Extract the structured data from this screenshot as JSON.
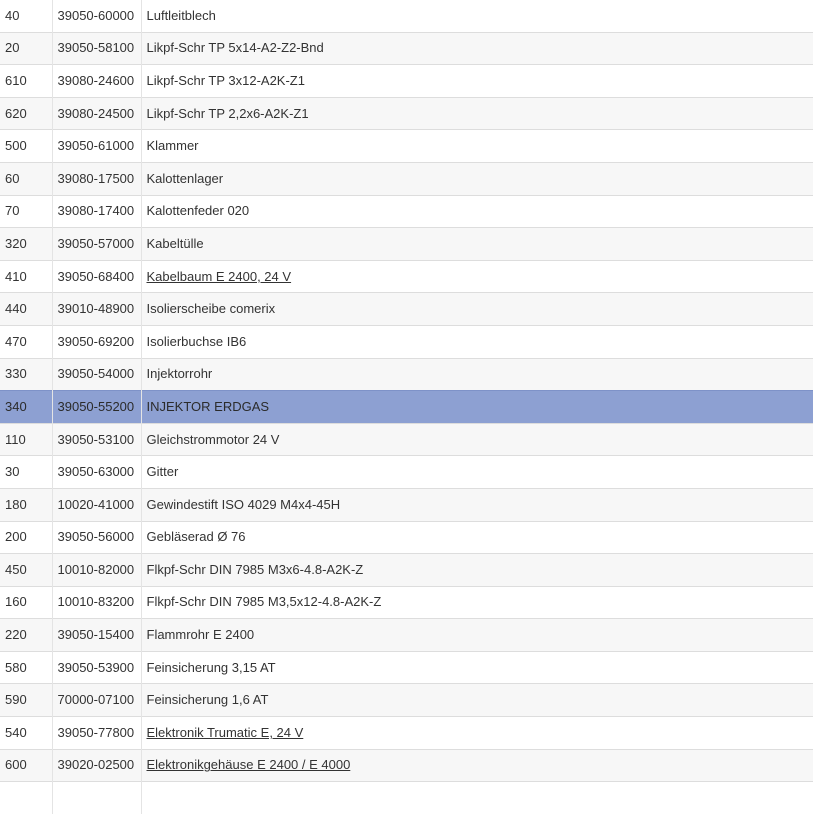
{
  "parts": [
    {
      "pos": "40",
      "number": "39050-60000",
      "description": "Luftleitblech",
      "link": false
    },
    {
      "pos": "20",
      "number": "39050-58100",
      "description": "Likpf-Schr TP 5x14-A2-Z2-Bnd",
      "link": false
    },
    {
      "pos": "610",
      "number": "39080-24600",
      "description": "Likpf-Schr TP 3x12-A2K-Z1",
      "link": false
    },
    {
      "pos": "620",
      "number": "39080-24500",
      "description": "Likpf-Schr TP 2,2x6-A2K-Z1",
      "link": false
    },
    {
      "pos": "500",
      "number": "39050-61000",
      "description": "Klammer",
      "link": false
    },
    {
      "pos": "60",
      "number": "39080-17500",
      "description": "Kalottenlager",
      "link": false
    },
    {
      "pos": "70",
      "number": "39080-17400",
      "description": "Kalottenfeder 020",
      "link": false
    },
    {
      "pos": "320",
      "number": "39050-57000",
      "description": "Kabeltülle",
      "link": false
    },
    {
      "pos": "410",
      "number": "39050-68400",
      "description": "Kabelbaum E 2400, 24 V",
      "link": true
    },
    {
      "pos": "440",
      "number": "39010-48900",
      "description": "Isolierscheibe comerix",
      "link": false
    },
    {
      "pos": "470",
      "number": "39050-69200",
      "description": "Isolierbuchse IB6",
      "link": false
    },
    {
      "pos": "330",
      "number": "39050-54000",
      "description": "Injektorrohr",
      "link": false
    },
    {
      "pos": "340",
      "number": "39050-55200",
      "description": "INJEKTOR ERDGAS",
      "link": false,
      "selected": true
    },
    {
      "pos": "110",
      "number": "39050-53100",
      "description": "Gleichstrommotor 24 V",
      "link": false
    },
    {
      "pos": "30",
      "number": "39050-63000",
      "description": "Gitter",
      "link": false
    },
    {
      "pos": "180",
      "number": "10020-41000",
      "description": "Gewindestift ISO 4029 M4x4-45H",
      "link": false
    },
    {
      "pos": "200",
      "number": "39050-56000",
      "description": "Gebläserad Ø 76",
      "link": false
    },
    {
      "pos": "450",
      "number": "10010-82000",
      "description": "Flkpf-Schr DIN 7985 M3x6-4.8-A2K-Z",
      "link": false
    },
    {
      "pos": "160",
      "number": "10010-83200",
      "description": "Flkpf-Schr DIN 7985 M3,5x12-4.8-A2K-Z",
      "link": false
    },
    {
      "pos": "220",
      "number": "39050-15400",
      "description": "Flammrohr E 2400",
      "link": false
    },
    {
      "pos": "580",
      "number": "39050-53900",
      "description": "Feinsicherung 3,15 AT",
      "link": false
    },
    {
      "pos": "590",
      "number": "70000-07100",
      "description": "Feinsicherung 1,6 AT",
      "link": false
    },
    {
      "pos": "540",
      "number": "39050-77800",
      "description": "Elektronik Trumatic E, 24 V",
      "link": true
    },
    {
      "pos": "600",
      "number": "39020-02500",
      "description": "Elektronikgehäuse E 2400 / E 4000",
      "link": true
    },
    {
      "pos": "",
      "number": "",
      "description": "",
      "link": false
    }
  ],
  "colors": {
    "row_even": "#f7f7f7",
    "row_odd": "#ffffff",
    "row_selected": "#8da0d2",
    "border": "#dddddd",
    "text": "#333333"
  }
}
